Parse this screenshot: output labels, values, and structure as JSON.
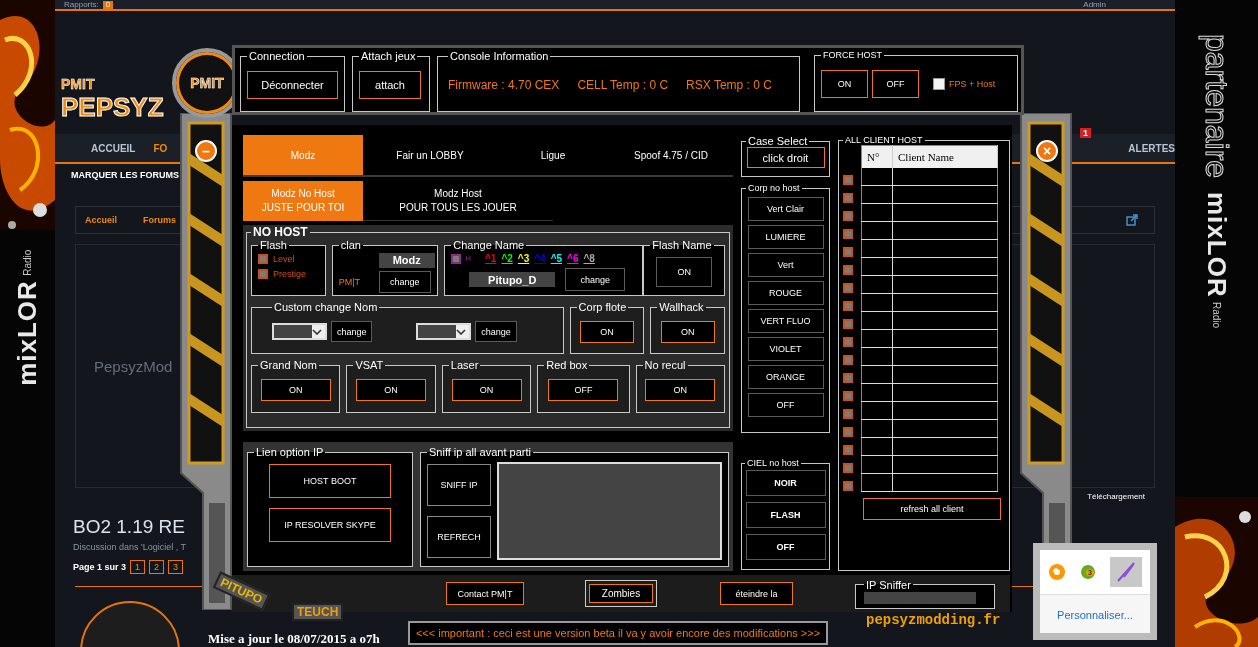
{
  "page": {
    "top_bar": {
      "reports_label": "Rapports:",
      "reports_count": "0",
      "user": "Admin"
    },
    "logo": {
      "small": "PMIT",
      "name": "PEPSYZ"
    },
    "nav": [
      {
        "label": "ACCUEIL",
        "selected": false
      },
      {
        "label": "FO",
        "selected": true
      },
      {
        "label": "ALERTES",
        "selected": false,
        "badge": "1"
      }
    ],
    "subnav": "MARQUER LES FORUMS",
    "breadcrumb": [
      "Accueil",
      "Forums"
    ],
    "banner_text": "PepsyzMod",
    "download_label": "Téléchargement",
    "thread_title": "BO2 1.19 RE",
    "thread_meta": "Discussion dans 'Logiciel , T",
    "pagination": {
      "label": "Page 1 sur 3",
      "pages": [
        "1",
        "2",
        "3"
      ]
    },
    "post_update": "Mise a jour le 08/07/2015 a o7h"
  },
  "banners": {
    "left": {
      "brand": "mixLOR",
      "sub": "Radio"
    },
    "right": {
      "caption": "partenaire",
      "brand": "mixLOR",
      "sub": "Radio"
    }
  },
  "app": {
    "logo": "PMIT",
    "minimize": "–",
    "close": "×",
    "connection": {
      "title": "Connection",
      "button": "Déconnecter"
    },
    "attach": {
      "title": "Attach  jeux",
      "button": "attach"
    },
    "console": {
      "title": "Console Information",
      "firmware": "Firmware : 4.70 CEX",
      "cell_temp": "CELL Temp : 0 C",
      "rsx_temp": "RSX Temp : 0 C"
    },
    "force_host": {
      "title": "FORCE HOST",
      "buttons": [
        "ON",
        "OFF"
      ],
      "fps_host": {
        "label": "FPS + Host",
        "checked": false
      }
    },
    "tabs": [
      {
        "label": "Modz",
        "selected": true
      },
      {
        "label": "Fair un LOBBY",
        "selected": false
      },
      {
        "label": "Ligue",
        "selected": false
      },
      {
        "label": "Spoof 4.75 / CID",
        "selected": false
      }
    ],
    "subtabs": [
      {
        "title": "Modz No Host",
        "subtitle": "JUSTE POUR TOI",
        "selected": true
      },
      {
        "title": "Modz Host",
        "subtitle": "POUR TOUS LES JOUER",
        "selected": false
      }
    ],
    "no_host": {
      "title": "NO HOST",
      "flash": {
        "title": "Flash",
        "options": [
          {
            "label": "Level",
            "checked": false
          },
          {
            "label": "Prestige",
            "checked": false
          }
        ]
      },
      "clan": {
        "title": "clan",
        "tag": "Modz",
        "prefix": "PM|T",
        "button": "change"
      },
      "change_name": {
        "title": "Change Name",
        "host": {
          "label": "H",
          "checked": false
        },
        "codes": [
          {
            "code": "^1",
            "color": "#ff0000"
          },
          {
            "code": "^2",
            "color": "#00ff00"
          },
          {
            "code": "^3",
            "color": "#ffff00"
          },
          {
            "code": "^4",
            "color": "#0000ff"
          },
          {
            "code": "^5",
            "color": "#00ffff"
          },
          {
            "code": "^6",
            "color": "#ff00ff"
          },
          {
            "code": "^8",
            "color": "#aaaaaa"
          }
        ],
        "name": "Pitupo_D",
        "button": "change"
      },
      "flash_name": {
        "title": "Flash Name",
        "button": "ON"
      },
      "custom": {
        "title": "Custom change Nom",
        "buttons": [
          "change",
          "change"
        ]
      },
      "toggles": [
        {
          "title": "Corp flote",
          "button": "ON"
        },
        {
          "title": "Wallhack",
          "button": "ON"
        }
      ],
      "options": [
        {
          "title": "Grand Nom",
          "button": "ON"
        },
        {
          "title": "VSAT",
          "button": "ON"
        },
        {
          "title": "Laser",
          "button": "ON"
        },
        {
          "title": "Red box",
          "button": "OFF"
        },
        {
          "title": "No recul",
          "button": "ON"
        }
      ]
    },
    "ip_links": {
      "title": "Lien option IP",
      "buttons": [
        "HOST BOOT",
        "IP RESOLVER SKYPE"
      ]
    },
    "sniff": {
      "title": "Sniff ip all avant parti",
      "buttons": [
        "SNIFF IP",
        "REFRECH"
      ]
    },
    "case_select": {
      "title": "Case Select",
      "button": "click droit"
    },
    "corp_no_host": {
      "title": "Corp no host",
      "buttons": [
        "Vert Clair",
        "LUMIERE",
        "Vert",
        "ROUGE",
        "VERT FLUO",
        "VIOLET",
        "ORANGE",
        "OFF"
      ]
    },
    "ciel_no_host": {
      "title": "CIEL no host",
      "buttons": [
        "NOIR",
        "FLASH",
        "OFF"
      ]
    },
    "clients": {
      "title": "ALL CLIENT HOST",
      "columns": [
        "N°",
        "Client Name"
      ],
      "checkboxes": [
        {
          "checked": false
        },
        {
          "checked": false
        },
        {
          "checked": false
        },
        {
          "checked": false
        },
        {
          "checked": false
        },
        {
          "checked": false
        },
        {
          "checked": false
        },
        {
          "checked": false
        },
        {
          "checked": false
        },
        {
          "checked": false
        },
        {
          "checked": false
        },
        {
          "checked": false
        },
        {
          "checked": false
        },
        {
          "checked": false
        },
        {
          "checked": false
        },
        {
          "checked": false
        },
        {
          "checked": false
        },
        {
          "checked": false
        }
      ],
      "button": "refresh all client"
    },
    "footer_buttons": [
      "Contact PM|T",
      "Zombies",
      "éteindre la"
    ],
    "ip_sniffer": {
      "title": "IP Sniffer"
    },
    "notice": "<<< important : ceci est une version beta il va y avoir encore des modifications >>>",
    "site": "pepsyzmodding.fr",
    "tags": [
      "PITUPO",
      "TEUCH"
    ]
  },
  "tray": {
    "badge": "3",
    "link": "Personnaliser..."
  }
}
